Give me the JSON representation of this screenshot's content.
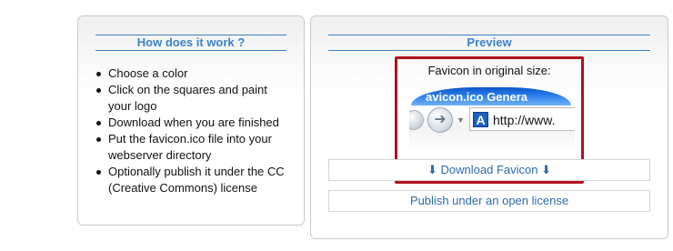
{
  "how_it_works": {
    "title": "How does it work ?",
    "steps": [
      "Choose a color",
      "Click on the squares and paint your logo",
      "Download when you are finished",
      "Put the favicon.ico file into your webserver directory",
      "Optionally publish it under the CC (Creative Commons) license"
    ]
  },
  "preview": {
    "title": "Preview",
    "favicon_caption": "Favicon in original size:",
    "browser": {
      "window_title": "avicon.ico Genera",
      "address_icon_letter": "A",
      "address_text": "http://www."
    },
    "download_button": "⬇ Download Favicon ⬇",
    "publish_button": "Publish under an open license"
  },
  "colors": {
    "header_blue": "#3a84c9",
    "link_blue": "#2f6aa6",
    "highlight_red": "#b0121b"
  }
}
